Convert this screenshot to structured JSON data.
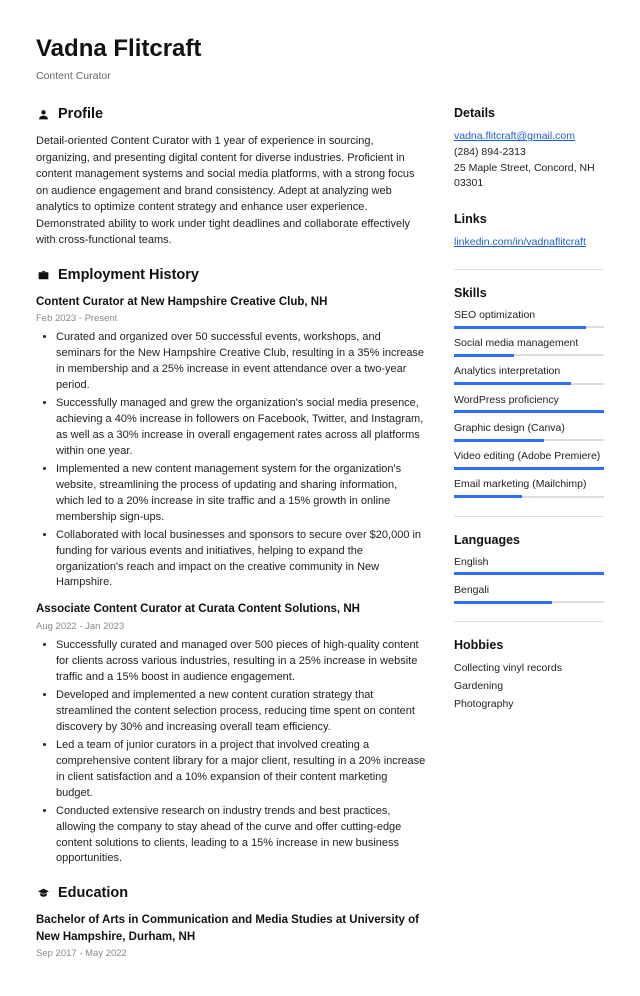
{
  "header": {
    "name": "Vadna Flitcraft",
    "subtitle": "Content Curator"
  },
  "profile": {
    "heading": "Profile",
    "text": "Detail-oriented Content Curator with 1 year of experience in sourcing, organizing, and presenting digital content for diverse industries. Proficient in content management systems and social media platforms, with a strong focus on audience engagement and brand consistency. Adept at analyzing web analytics to optimize content strategy and enhance user experience. Demonstrated ability to work under tight deadlines and collaborate effectively with cross-functional teams."
  },
  "employment": {
    "heading": "Employment History",
    "jobs": [
      {
        "title": "Content Curator at New Hampshire Creative Club, NH",
        "dates": "Feb 2023 - Present",
        "bullets": [
          "Curated and organized over 50 successful events, workshops, and seminars for the New Hampshire Creative Club, resulting in a 35% increase in membership and a 25% increase in event attendance over a two-year period.",
          "Successfully managed and grew the organization's social media presence, achieving a 40% increase in followers on Facebook, Twitter, and Instagram, as well as a 30% increase in overall engagement rates across all platforms within one year.",
          "Implemented a new content management system for the organization's website, streamlining the process of updating and sharing information, which led to a 20% increase in site traffic and a 15% growth in online membership sign-ups.",
          "Collaborated with local businesses and sponsors to secure over $20,000 in funding for various events and initiatives, helping to expand the organization's reach and impact on the creative community in New Hampshire."
        ]
      },
      {
        "title": "Associate Content Curator at Curata Content Solutions, NH",
        "dates": "Aug 2022 - Jan 2023",
        "bullets": [
          "Successfully curated and managed over 500 pieces of high-quality content for clients across various industries, resulting in a 25% increase in website traffic and a 15% boost in audience engagement.",
          "Developed and implemented a new content curation strategy that streamlined the content selection process, reducing time spent on content discovery by 30% and increasing overall team efficiency.",
          "Led a team of junior curators in a project that involved creating a comprehensive content library for a major client, resulting in a 20% increase in client satisfaction and a 10% expansion of their content marketing budget.",
          "Conducted extensive research on industry trends and best practices, allowing the company to stay ahead of the curve and offer cutting-edge content solutions to clients, leading to a 15% increase in new business opportunities."
        ]
      }
    ]
  },
  "education": {
    "heading": "Education",
    "entries": [
      {
        "title": "Bachelor of Arts in Communication and Media Studies at University of New Hampshire, Durham, NH",
        "dates": "Sep 2017 - May 2022"
      }
    ]
  },
  "details": {
    "heading": "Details",
    "email": "vadna.flitcraft@gmail.com",
    "phone": "(284) 894-2313",
    "address": "25 Maple Street, Concord, NH 03301"
  },
  "links": {
    "heading": "Links",
    "items": [
      "linkedin.com/in/vadnaflitcraft"
    ]
  },
  "skills": {
    "heading": "Skills",
    "items": [
      {
        "label": "SEO optimization",
        "pct": 88
      },
      {
        "label": "Social media management",
        "pct": 40
      },
      {
        "label": "Analytics interpretation",
        "pct": 78
      },
      {
        "label": "WordPress proficiency",
        "pct": 100
      },
      {
        "label": "Graphic design (Canva)",
        "pct": 60
      },
      {
        "label": "Video editing (Adobe Premiere)",
        "pct": 100
      },
      {
        "label": "Email marketing (Mailchimp)",
        "pct": 45
      }
    ]
  },
  "languages": {
    "heading": "Languages",
    "items": [
      {
        "label": "English",
        "pct": 100
      },
      {
        "label": "Bengali",
        "pct": 65
      }
    ]
  },
  "hobbies": {
    "heading": "Hobbies",
    "items": [
      "Collecting vinyl records",
      "Gardening",
      "Photography"
    ]
  }
}
